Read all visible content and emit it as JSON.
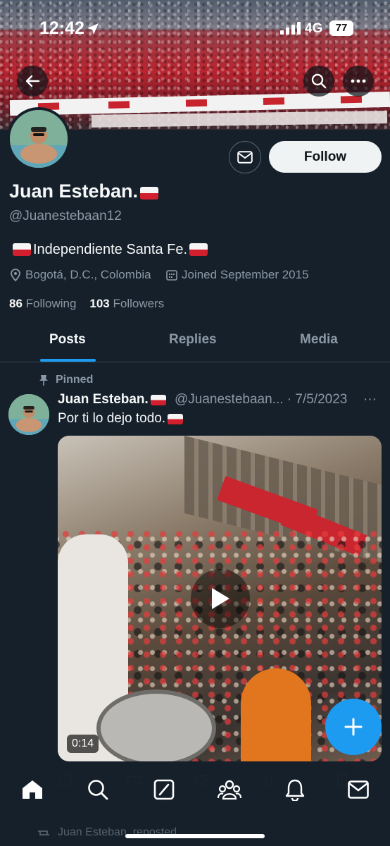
{
  "status_bar": {
    "time": "12:42",
    "network": "4G",
    "battery": "77"
  },
  "profile": {
    "name": "Juan Esteban.",
    "handle": "@Juanestebaan12",
    "bio": "Independiente Santa Fe.",
    "location": "Bogotá, D.C., Colombia",
    "joined": "Joined September 2015",
    "following_count": "86",
    "following_label": "Following",
    "followers_count": "103",
    "followers_label": "Followers",
    "follow_button": "Follow"
  },
  "tabs": [
    {
      "label": "Posts",
      "active": true
    },
    {
      "label": "Replies",
      "active": false
    },
    {
      "label": "Media",
      "active": false
    }
  ],
  "post": {
    "pinned_label": "Pinned",
    "author": "Juan Esteban.",
    "handle": "@Juanestebaan...",
    "date": "7/5/2023",
    "separator": "·",
    "more": "···",
    "text": "Por ti lo dejo todo.",
    "video_duration": "0:14"
  },
  "next_post": {
    "reposted_text": "Juan Esteban. reposted"
  },
  "colors": {
    "background": "#15202b",
    "accent": "#1d9bf0",
    "muted": "#8b98a5",
    "divider": "#38444d"
  },
  "nav_icons": [
    "home-icon",
    "search-icon",
    "grok-icon",
    "communities-icon",
    "notifications-icon",
    "messages-icon"
  ]
}
